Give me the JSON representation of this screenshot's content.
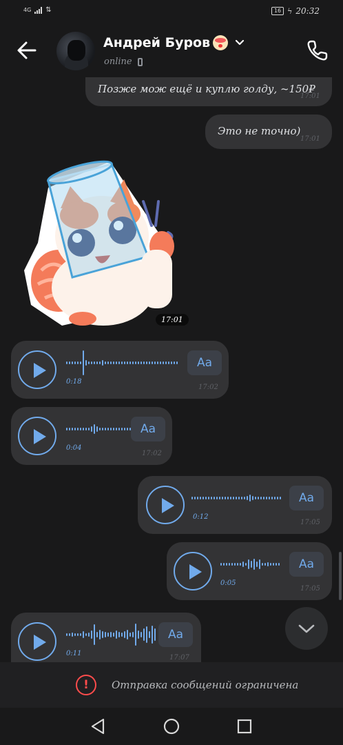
{
  "status_bar": {
    "network": "4G",
    "battery": "16",
    "time": "20:32"
  },
  "header": {
    "back_icon": "arrow-left-icon",
    "name": "Андрей Буров",
    "subtitle": "online",
    "call_icon": "phone-icon"
  },
  "messages": {
    "m1_text": "Позже мож ещё и куплю голду, ~150₽",
    "m1_time": "17:01",
    "m2_text": "Это не точно)",
    "m2_time": "17:01",
    "sticker_time": "17:01",
    "v1_duration": "0:18",
    "v1_time": "17:02",
    "v1_aa": "Aa",
    "v2_duration": "0:04",
    "v2_time": "17:02",
    "v2_aa": "Aa",
    "v3_duration": "0:12",
    "v3_time": "17:05",
    "v3_aa": "Aa",
    "v4_duration": "0:05",
    "v4_time": "17:05",
    "v4_aa": "Aa",
    "v5_duration": "0:11",
    "v5_time": "17:07",
    "v5_aa": "Aa"
  },
  "restricted": {
    "icon": "exclamation-icon",
    "text": "Отправка сообщений ограничена"
  },
  "colors": {
    "background": "#19191a",
    "bubble": "#333335",
    "accent": "#71aaeb",
    "warning": "#ff4c4c"
  }
}
